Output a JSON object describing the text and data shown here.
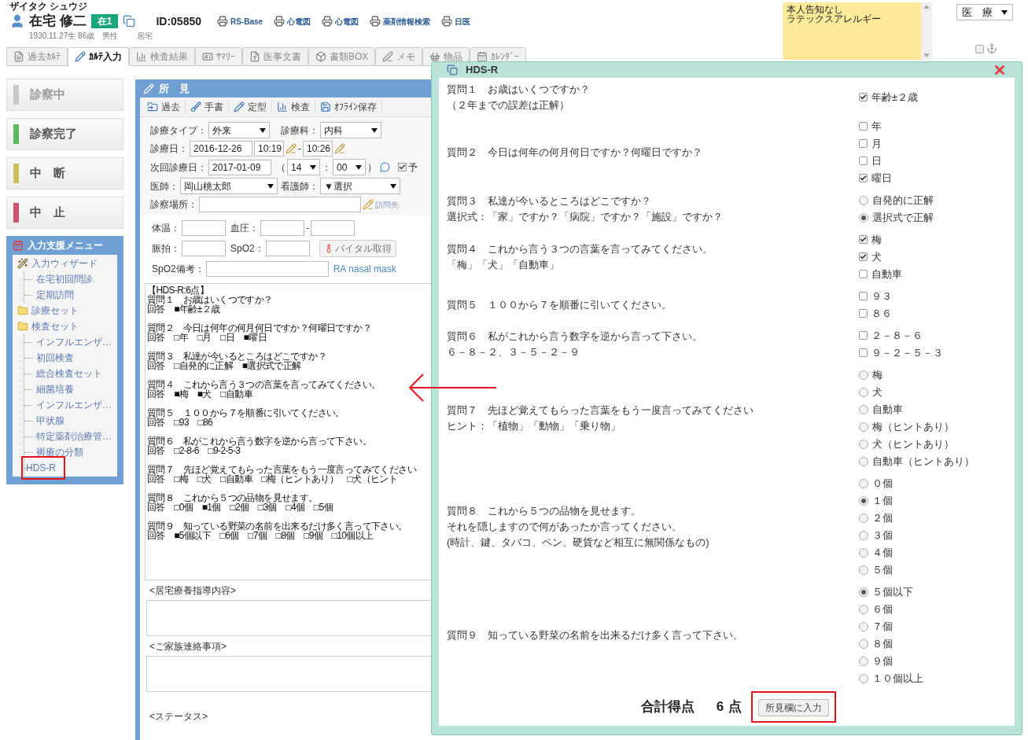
{
  "patient": {
    "kana": "ザイタク シュウジ",
    "name": "在宅 修二",
    "badge": "在1",
    "id": "ID:05850",
    "birth": "1930.11.27生 86歳　男性",
    "residence": "居宅"
  },
  "links": [
    "RS-Base",
    "心電図",
    "心電図",
    "薬剤情報検索",
    "日医"
  ],
  "notice": {
    "lines": [
      "本人告知なし",
      "ラテックスアレルギー"
    ]
  },
  "mode_select": "医　療",
  "pin": {
    "checked": false
  },
  "tabs": [
    {
      "label": "過去ｶﾙﾃ",
      "selected": false
    },
    {
      "label": "ｶﾙﾃ入力",
      "selected": true
    },
    {
      "label": "検査結果",
      "selected": false
    },
    {
      "label": "ｻﾏﾘｰ",
      "selected": false
    },
    {
      "label": "医事文書",
      "selected": false
    },
    {
      "label": "書類BOX",
      "selected": false
    },
    {
      "label": "メモ",
      "selected": false
    },
    {
      "label": "物品",
      "selected": false
    },
    {
      "label": "ｶﾚﾝﾀﾞｰ",
      "selected": false
    }
  ],
  "status_buttons": [
    {
      "label": "診察中",
      "color": "#c8c8c8",
      "disabled": true
    },
    {
      "label": "診察完了",
      "color": "#5cb85c",
      "disabled": false
    },
    {
      "label": "中　断",
      "color": "#c9bf5b",
      "disabled": false
    },
    {
      "label": "中　止",
      "color": "#c9566a",
      "disabled": false
    }
  ],
  "support_menu": {
    "title": "入力支援メニュー",
    "items": [
      {
        "label": "入力ウィザード",
        "kind": "wizard",
        "children": [
          {
            "label": "在宅初回問診",
            "marked": false
          },
          {
            "label": "定期訪問",
            "marked": false
          }
        ]
      },
      {
        "label": "診療セット",
        "kind": "folder"
      },
      {
        "label": "検査セット",
        "kind": "folder",
        "children": [
          {
            "label": "インフルエンザ…",
            "marked": false
          },
          {
            "label": "初回検査",
            "marked": false
          },
          {
            "label": "総合検査セット",
            "marked": false
          },
          {
            "label": "細菌培養",
            "marked": false
          },
          {
            "label": "インフルエンザ…",
            "marked": false
          },
          {
            "label": "甲状腺",
            "marked": false
          },
          {
            "label": "特定薬剤治療管…",
            "marked": false
          },
          {
            "label": "褥瘡の分類",
            "marked": false
          },
          {
            "label": "HDS-R",
            "marked": true
          }
        ]
      }
    ]
  },
  "findings": {
    "title": "所　見",
    "toolbar": [
      "過去",
      "手書",
      "定型",
      "検査",
      "ｵﾌﾗｲﾝ保存"
    ],
    "form": {
      "type_label": "診療タイプ：",
      "type": "外来",
      "dept_label": "診療科：",
      "dept": "内科",
      "date_label": "診療日：",
      "date": "2016-12-26",
      "start": "10:19",
      "range_sep": "-",
      "end": "10:26",
      "next_label": "次回診療日：",
      "next_date": "2017-01-09",
      "paren_open": "（",
      "hour": "14",
      "time_sep": "：",
      "minute": "00",
      "paren_close": "）",
      "scheduled": {
        "label": "予",
        "checked": true
      },
      "doctor_label": "医師：",
      "doctor": "岡山桃太郎",
      "nurse_label": "看護師：",
      "nurse": "▼選択",
      "place_label": "診察場所：",
      "visit_link": "訪問先"
    },
    "vitals": {
      "temp_label": "体温：",
      "bp_label": "血圧：",
      "bp_sep": "-",
      "pulse_label": "脈拍：",
      "spo2_label": "SpO2：",
      "fetch_button": "バイタル取得",
      "spo2_note_label": "SpO2備考：",
      "spo2_note_hint": "RA nasal mask"
    },
    "note": {
      "header": "【HDS-R:6点】",
      "entries": [
        {
          "question": "質問１　お歳はいくつですか？",
          "answer": "回答　■年齢±２歳"
        },
        {
          "question": "質問２　今日は何年の何月何日ですか？何曜日ですか？",
          "answer": "回答　□年　□月　□日　■曜日"
        },
        {
          "question": "質問３　私達が今いるところはどこですか？",
          "answer": "回答　□自発的に正解　■選択式で正解"
        },
        {
          "question": "質問４　これから言う３つの言葉を言ってみてください。",
          "answer": "回答　■梅　■犬　□自動車"
        },
        {
          "question": "質問５　１００から７を順番に引いてください。",
          "answer": "回答　□93　□86"
        },
        {
          "question": "質問６　私がこれから言う数字を逆から言って下さい。",
          "answer": "回答　□2-8-6　□9-2-5-3"
        },
        {
          "question": "質問７　先ほど覚えてもらった言葉をもう一度言ってみてください",
          "answer": "回答　□梅　□犬　□自動車　□梅（ヒントあり）　□犬（ヒント"
        },
        {
          "question": "質問８　これから５つの品物を見せます。",
          "answer": "回答　□0個　■1個　□2個　□3個　□4個　□5個"
        },
        {
          "question": "質問９　知っている野菜の名前を出来るだけ多く言って下さい。",
          "answer": "回答　■5個以下　□6個　□7個　□8個　□9個　□10個以上"
        }
      ]
    },
    "sections": [
      "<居宅療養指導内容>",
      "<ご家族連絡事項>"
    ],
    "status_label": "<ステータス>"
  },
  "annotation_arrow": true,
  "dialog": {
    "title": "HDS-R",
    "questions": [
      {
        "lines": [
          "質問１　お歳はいくつですか？",
          "（２年までの誤差は正解）"
        ],
        "options": [
          {
            "kind": "checkbox",
            "label": "年齢±２歳",
            "checked": true
          }
        ]
      },
      {
        "lines": [
          "質問２　今日は何年の何月何日ですか？何曜日ですか？"
        ],
        "options": [
          {
            "kind": "checkbox",
            "label": "年",
            "checked": false
          },
          {
            "kind": "checkbox",
            "label": "月",
            "checked": false
          },
          {
            "kind": "checkbox",
            "label": "日",
            "checked": false
          },
          {
            "kind": "checkbox",
            "label": "曜日",
            "checked": true
          }
        ]
      },
      {
        "lines": [
          "質問３　私達が今いるところはどこですか？",
          "選択式：「家」ですか？「病院」ですか？「施設」ですか？"
        ],
        "options": [
          {
            "kind": "radio",
            "label": "自発的に正解",
            "selected": false
          },
          {
            "kind": "radio",
            "label": "選択式で正解",
            "selected": true
          }
        ]
      },
      {
        "lines": [
          "質問４　これから言う３つの言葉を言ってみてください。",
          "「梅」「犬」「自動車」"
        ],
        "options": [
          {
            "kind": "checkbox",
            "label": "梅",
            "checked": true
          },
          {
            "kind": "checkbox",
            "label": "犬",
            "checked": true
          },
          {
            "kind": "checkbox",
            "label": "自動車",
            "checked": false
          }
        ]
      },
      {
        "lines": [
          "質問５　１００から７を順番に引いてください。"
        ],
        "options": [
          {
            "kind": "checkbox",
            "label": "９３",
            "checked": false
          },
          {
            "kind": "checkbox",
            "label": "８６",
            "checked": false
          }
        ]
      },
      {
        "lines": [
          "質問６　私がこれから言う数字を逆から言って下さい。",
          "６－８－２、３－５－２－９"
        ],
        "options": [
          {
            "kind": "checkbox",
            "label": "２－８－６",
            "checked": false
          },
          {
            "kind": "checkbox",
            "label": "９－２－５－３",
            "checked": false
          }
        ]
      },
      {
        "lines": [
          "質問７　先ほど覚えてもらった言葉をもう一度言ってみてください",
          "ヒント：「植物」「動物」「乗り物」"
        ],
        "options": [
          {
            "kind": "radio",
            "label": "梅",
            "selected": false
          },
          {
            "kind": "radio",
            "label": "犬",
            "selected": false
          },
          {
            "kind": "radio",
            "label": "自動車",
            "selected": false
          },
          {
            "kind": "radio",
            "label": "梅（ヒントあり）",
            "selected": false
          },
          {
            "kind": "radio",
            "label": "犬（ヒントあり）",
            "selected": false
          },
          {
            "kind": "radio",
            "label": "自動車（ヒントあり）",
            "selected": false
          }
        ]
      },
      {
        "lines": [
          "質問８　これから５つの品物を見せます。",
          "それを隠しますので何があったか言ってください。",
          "(時計、鍵、タバコ、ペン、硬貨など相互に無関係なもの)"
        ],
        "options": [
          {
            "kind": "radio",
            "label": "０個",
            "selected": false
          },
          {
            "kind": "radio",
            "label": "１個",
            "selected": true
          },
          {
            "kind": "radio",
            "label": "２個",
            "selected": false
          },
          {
            "kind": "radio",
            "label": "３個",
            "selected": false
          },
          {
            "kind": "radio",
            "label": "４個",
            "selected": false
          },
          {
            "kind": "radio",
            "label": "５個",
            "selected": false
          }
        ]
      },
      {
        "lines": [
          "質問９　知っている野菜の名前を出来るだけ多く言って下さい。"
        ],
        "options": [
          {
            "kind": "radio",
            "label": "５個以下",
            "selected": true
          },
          {
            "kind": "radio",
            "label": "６個",
            "selected": false
          },
          {
            "kind": "radio",
            "label": "７個",
            "selected": false
          },
          {
            "kind": "radio",
            "label": "８個",
            "selected": false
          },
          {
            "kind": "radio",
            "label": "９個",
            "selected": false
          },
          {
            "kind": "radio",
            "label": "１０個以上",
            "selected": false
          }
        ]
      }
    ],
    "total_label": "合計得点",
    "total": "6",
    "unit": "点",
    "submit": {
      "label": "所見欄に入力",
      "marked": true
    }
  }
}
